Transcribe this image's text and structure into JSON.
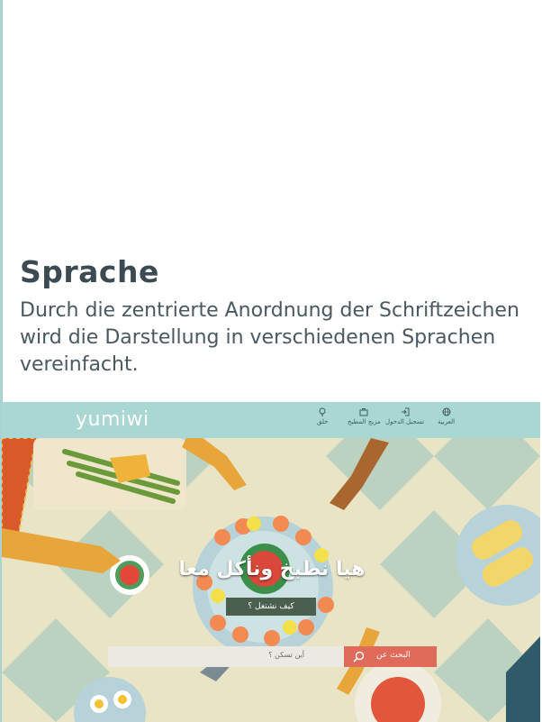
{
  "section": {
    "heading": "Sprache",
    "body": "Durch die zentrierte Anordnung der Schriftzeichen wird die Darstellung in verschiedenen Sprachen vereinfacht."
  },
  "screenshot": {
    "logo": "yumiwi",
    "nav": [
      {
        "icon": "globe-icon",
        "label": "العربية"
      },
      {
        "icon": "login-icon",
        "label": "تسجيل الدخول"
      },
      {
        "icon": "bag-icon",
        "label": "مزيج المطبخ"
      },
      {
        "icon": "lightbulb-icon",
        "label": "خلق"
      }
    ],
    "hero_title": "هيا نطبخ ونأكل معا",
    "how_button": "كيف نشتغل ؟",
    "search_placeholder": "أين تسكن ؟",
    "search_button": "البحث عن",
    "colors": {
      "topbar": "#a9d8d4",
      "search_button": "#e06b5b",
      "heading": "#3c4a52"
    }
  }
}
